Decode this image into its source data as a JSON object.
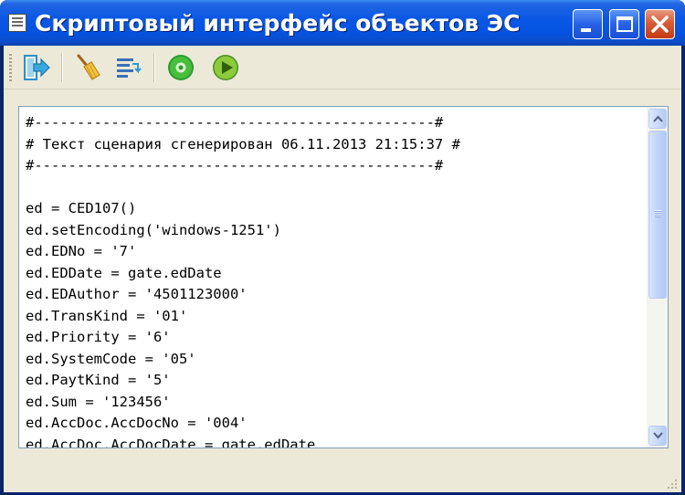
{
  "window": {
    "title": "Скриптовый интерфейс объектов ЭС"
  },
  "toolbar": {
    "items": [
      {
        "icon": "exit-icon"
      },
      {
        "icon": "broom-icon"
      },
      {
        "icon": "format-lines-icon"
      },
      {
        "icon": "record-icon"
      },
      {
        "icon": "play-icon"
      }
    ]
  },
  "editor": {
    "lines": [
      "#-----------------------------------------------#",
      "# Текст сценария сгенерирован 06.11.2013 21:15:37 #",
      "#-----------------------------------------------#",
      "",
      "ed = CED107()",
      "ed.setEncoding('windows-1251')",
      "ed.EDNo = '7'",
      "ed.EDDate = gate.edDate",
      "ed.EDAuthor = '4501123000'",
      "ed.TransKind = '01'",
      "ed.Priority = '6'",
      "ed.SystemCode = '05'",
      "ed.PaytKind = '5'",
      "ed.Sum = '123456'",
      "ed.AccDoc.AccDocNo = '004'",
      "ed.AccDoc.AccDocDate = gate.edDate"
    ]
  },
  "colors": {
    "titlebar": "#0553e1",
    "client": "#ece9d8",
    "close_button": "#d85b35",
    "editor_border": "#7f9db9"
  }
}
